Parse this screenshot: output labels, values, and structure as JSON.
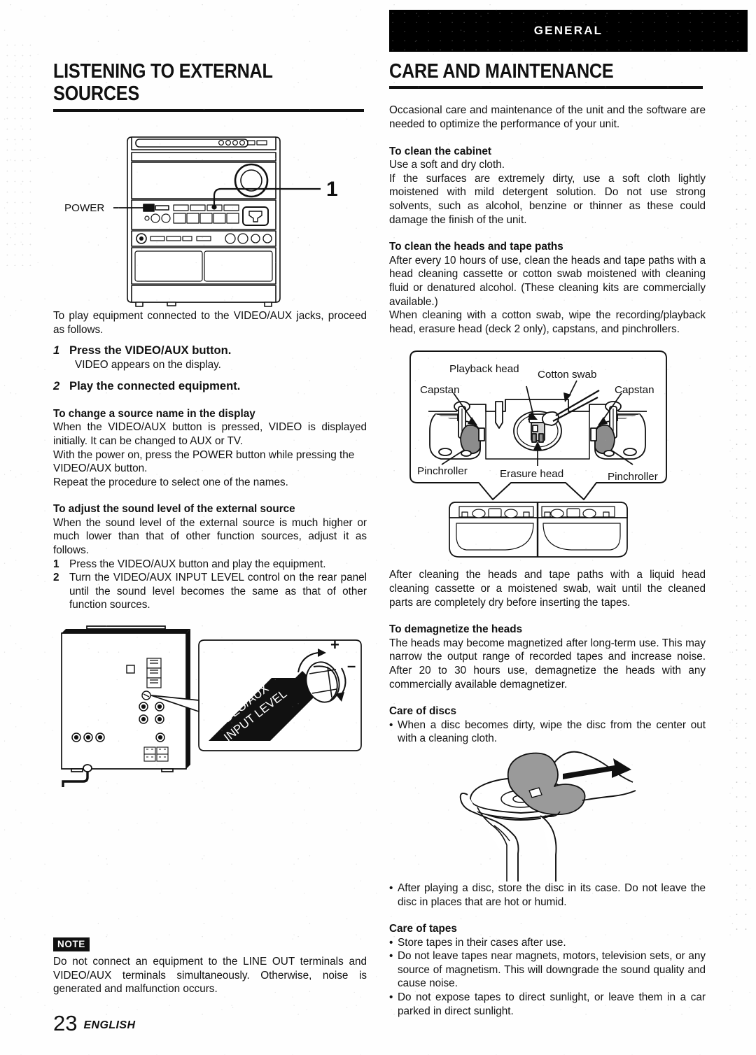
{
  "page": {
    "number": "23",
    "language": "ENGLISH",
    "band_label": "GENERAL"
  },
  "left": {
    "title": "LISTENING TO EXTERNAL SOURCES",
    "figure_front": {
      "power_label": "POWER",
      "callout": "1"
    },
    "intro": "To play equipment connected to the VIDEO/AUX jacks, proceed as follows.",
    "steps": [
      {
        "num": "1",
        "lead": "Press the VIDEO/AUX button.",
        "sub": "VIDEO appears on the display."
      },
      {
        "num": "2",
        "lead": "Play the connected equipment.",
        "sub": ""
      }
    ],
    "source_name": {
      "heading": "To change a source name in the display",
      "p1": "When the VIDEO/AUX button is pressed, VIDEO is displayed initially.  It can be changed to AUX or TV.",
      "p2": "With the power on, press the POWER button while pressing the VIDEO/AUX button.",
      "p3": "Repeat the procedure to select one of the names."
    },
    "sound_level": {
      "heading": "To adjust the sound level of the external source",
      "p1": "When the sound level of the external source is much higher or much lower than that of other function sources, adjust it as follows.",
      "steps": [
        {
          "num": "1",
          "text": "Press the VIDEO/AUX button and play the equipment."
        },
        {
          "num": "2",
          "text": "Turn the VIDEO/AUX INPUT LEVEL control on the rear panel until the sound level becomes the same as that of other function sources."
        }
      ]
    },
    "figure_rear": {
      "tag_line1": "VIDEO/AUX",
      "tag_line2": "INPUT LEVEL",
      "knob_plus": "+",
      "knob_minus": "–"
    },
    "note": {
      "badge": "NOTE",
      "text": "Do not connect an equipment to the LINE OUT terminals and VIDEO/AUX terminals simultaneously. Otherwise, noise is generated and malfunction occurs."
    }
  },
  "right": {
    "title": "CARE AND MAINTENANCE",
    "intro": "Occasional care and maintenance of the unit and the software are needed to optimize the performance of your unit.",
    "cabinet": {
      "heading": "To clean the cabinet",
      "p1": "Use a soft and dry cloth.",
      "p2": "If the surfaces are extremely dirty, use a soft cloth lightly moistened with mild detergent solution.  Do not use strong solvents, such as alcohol, benzine or thinner as these could damage the finish of the unit."
    },
    "heads": {
      "heading": "To clean the heads and tape paths",
      "p1": "After every 10 hours of use, clean the heads and tape paths with a head cleaning cassette or cotton swab moistened with cleaning fluid or denatured alcohol. (These cleaning kits are commercially available.)",
      "p2": "When cleaning with a cotton swab, wipe the recording/playback head, erasure head (deck 2 only), capstans, and pinchrollers."
    },
    "figure_heads": {
      "playback_head": "Playback head",
      "cotton_swab": "Cotton swab",
      "capstan_left": "Capstan",
      "capstan_right": "Capstan",
      "pinchroller_left": "Pinchroller",
      "pinchroller_right": "Pinchroller",
      "erasure_head": "Erasure head"
    },
    "after_clean": "After cleaning the heads and tape paths with a liquid head cleaning cassette or a moistened swab, wait until the cleaned parts are completely dry before inserting the tapes.",
    "demagnetize": {
      "heading": "To demagnetize the heads",
      "p1": "The heads may become magnetized after long-term use.  This may narrow the output range of recorded tapes and increase noise.  After 20 to 30 hours use, demagnetize the heads with any commercially available demagnetizer."
    },
    "discs": {
      "heading": "Care of discs",
      "bullets": [
        "When a disc becomes dirty, wipe the disc from the center out with a cleaning cloth.",
        "After playing a disc, store the disc in its case. Do not leave the disc in places that are hot or humid."
      ]
    },
    "tapes": {
      "heading": "Care of tapes",
      "bullets": [
        "Store tapes in their cases after use.",
        "Do not leave tapes near magnets, motors, television sets, or any source of magnetism.  This will downgrade the sound quality and cause noise.",
        "Do not expose tapes to direct sunlight, or leave them in a car parked in direct sunlight."
      ]
    }
  }
}
